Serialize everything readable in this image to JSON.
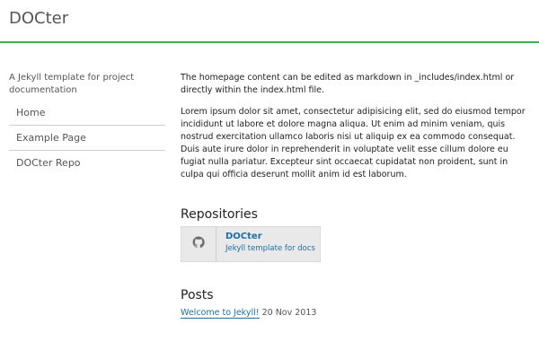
{
  "header": {
    "site_title": "DOCter",
    "accent_color": "#3db349"
  },
  "sidebar": {
    "description": "A Jekyll template for project documentation",
    "nav": [
      {
        "label": "Home"
      },
      {
        "label": "Example Page"
      },
      {
        "label": "DOCter Repo"
      }
    ]
  },
  "main": {
    "intro": "The homepage content can be edited as markdown in _includes/index.html or directly within the index.html file.",
    "lorem": "Lorem ipsum dolor sit amet, consectetur adipisicing elit, sed do eiusmod tempor incididunt ut labore et dolore magna aliqua. Ut enim ad minim veniam, quis nostrud exercitation ullamco laboris nisi ut aliquip ex ea commodo consequat. Duis aute irure dolor in reprehenderit in voluptate velit esse cillum dolore eu fugiat nulla pariatur. Excepteur sint occaecat cupidatat non proident, sunt in culpa qui officia deserunt mollit anim id est laborum.",
    "repositories": {
      "title": "Repositories",
      "items": [
        {
          "name": "DOCter",
          "description": "Jekyll template for docs",
          "icon": "github-icon"
        }
      ]
    },
    "posts": {
      "title": "Posts",
      "items": [
        {
          "title": "Welcome to Jekyll!",
          "date": "20 Nov 2013"
        }
      ]
    }
  }
}
